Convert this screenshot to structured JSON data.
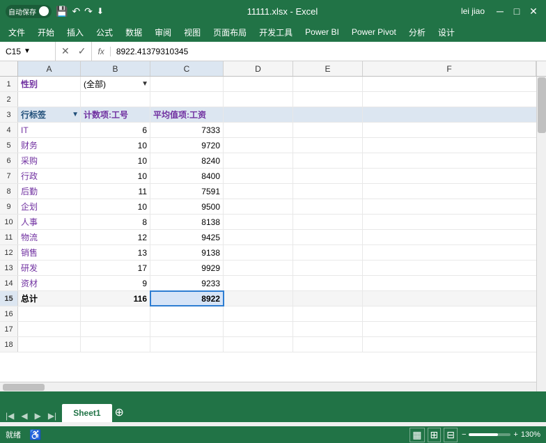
{
  "titlebar": {
    "autosave_label": "自动保存",
    "autosave_on": "●",
    "filename": "11111.xlsx - Excel",
    "username": "lei jiao",
    "save_icon": "💾",
    "undo_icon": "↶",
    "redo_icon": "↷",
    "tools_icon": "⬇"
  },
  "menubar": {
    "items": [
      "文件",
      "开始",
      "插入",
      "公式",
      "数据",
      "审阅",
      "视图",
      "页面布局",
      "开发工具",
      "Power BI",
      "Power Pivot",
      "分析",
      "设计"
    ]
  },
  "formulabar": {
    "cell_ref": "C15",
    "formula_value": "8922.41379310345",
    "fx_label": "fx"
  },
  "columns": {
    "headers": [
      "A",
      "B",
      "C",
      "D",
      "E",
      "F"
    ],
    "widths": [
      90,
      100,
      105,
      100,
      100,
      90
    ]
  },
  "rows": [
    {
      "num": 1,
      "cells": [
        "性别",
        "(全部)",
        "",
        "",
        "",
        ""
      ]
    },
    {
      "num": 2,
      "cells": [
        "",
        "",
        "",
        "",
        "",
        ""
      ]
    },
    {
      "num": 3,
      "cells": [
        "行标签",
        "计数项:工号",
        "平均值项:工资",
        "",
        "",
        ""
      ]
    },
    {
      "num": 4,
      "cells": [
        "IT",
        "6",
        "7333",
        "",
        "",
        ""
      ]
    },
    {
      "num": 5,
      "cells": [
        "财务",
        "10",
        "9720",
        "",
        "",
        ""
      ]
    },
    {
      "num": 6,
      "cells": [
        "采购",
        "10",
        "8240",
        "",
        "",
        ""
      ]
    },
    {
      "num": 7,
      "cells": [
        "行政",
        "10",
        "8400",
        "",
        "",
        ""
      ]
    },
    {
      "num": 8,
      "cells": [
        "后勤",
        "11",
        "7591",
        "",
        "",
        ""
      ]
    },
    {
      "num": 9,
      "cells": [
        "企划",
        "10",
        "9500",
        "",
        "",
        ""
      ]
    },
    {
      "num": 10,
      "cells": [
        "人事",
        "8",
        "8138",
        "",
        "",
        ""
      ]
    },
    {
      "num": 11,
      "cells": [
        "物流",
        "12",
        "9425",
        "",
        "",
        ""
      ]
    },
    {
      "num": 12,
      "cells": [
        "销售",
        "13",
        "9138",
        "",
        "",
        ""
      ]
    },
    {
      "num": 13,
      "cells": [
        "研发",
        "17",
        "9929",
        "",
        "",
        ""
      ]
    },
    {
      "num": 14,
      "cells": [
        "资材",
        "9",
        "9233",
        "",
        "",
        ""
      ]
    },
    {
      "num": 15,
      "cells": [
        "总计",
        "116",
        "8922",
        "",
        "",
        ""
      ]
    },
    {
      "num": 16,
      "cells": [
        "",
        "",
        "",
        "",
        "",
        ""
      ]
    },
    {
      "num": 17,
      "cells": [
        "",
        "",
        "",
        "",
        "",
        ""
      ]
    },
    {
      "num": 18,
      "cells": [
        "",
        "",
        "",
        "",
        "",
        ""
      ]
    }
  ],
  "statusbar": {
    "ready_label": "就绪",
    "sheet_name": "Sheet1",
    "zoom_level": "130%"
  }
}
